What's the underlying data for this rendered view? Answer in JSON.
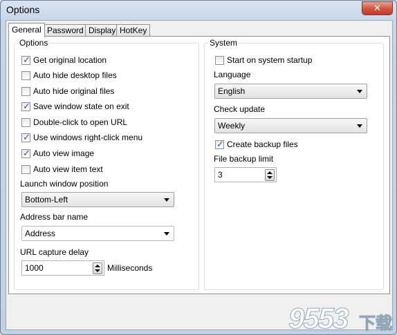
{
  "window": {
    "title": "Options",
    "close_glyph": "✕"
  },
  "tabs": [
    {
      "label": "General",
      "active": true
    },
    {
      "label": "Password",
      "active": false
    },
    {
      "label": "Display",
      "active": false
    },
    {
      "label": "HotKey",
      "active": false
    }
  ],
  "options": {
    "group_label": "Options",
    "checkboxes": [
      {
        "label": "Get original location",
        "checked": true
      },
      {
        "label": "Auto hide desktop files",
        "checked": false
      },
      {
        "label": "Auto hide original files",
        "checked": false
      },
      {
        "label": "Save window state on exit",
        "checked": true
      },
      {
        "label": "Double-click to open URL",
        "checked": false
      },
      {
        "label": "Use windows right-click menu",
        "checked": true
      },
      {
        "label": "Auto view image",
        "checked": true
      },
      {
        "label": "Auto view item text",
        "checked": false
      }
    ],
    "launch_position": {
      "label": "Launch window position",
      "value": "Bottom-Left"
    },
    "address_bar": {
      "label": "Address bar name",
      "value": "Address"
    },
    "url_delay": {
      "label": "URL capture delay",
      "value": "1000",
      "unit": "Milliseconds"
    }
  },
  "system": {
    "group_label": "System",
    "startup": {
      "label": "Start on system startup",
      "checked": false
    },
    "language": {
      "label": "Language",
      "value": "English"
    },
    "update": {
      "label": "Check update",
      "value": "Weekly"
    },
    "backup": {
      "label": "Create backup files",
      "checked": true
    },
    "backup_limit": {
      "label": "File backup limit",
      "value": "3"
    }
  },
  "watermark": {
    "number": "9553",
    "suffix": "下载"
  },
  "colors": {
    "check_mark": "#2a5c9a",
    "close_button": "#cf553f"
  }
}
